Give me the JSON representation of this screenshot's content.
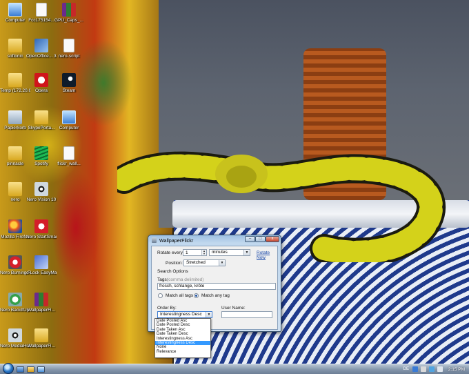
{
  "desktop": {
    "icons": [
      {
        "label": "Computer",
        "icon": "computer-icon"
      },
      {
        "label": "Fcc175154...",
        "icon": "file-icon"
      },
      {
        "label": "GPU_Caps_...",
        "icon": "archive-icon"
      },
      {
        "label": "softonic",
        "icon": "folder-icon"
      },
      {
        "label": "OpenOffice... 3.2",
        "icon": "openoffice-icon"
      },
      {
        "label": "nero-script",
        "icon": "file-icon"
      },
      {
        "label": "Temp (172.20.60...",
        "icon": "folder-icon"
      },
      {
        "label": "Opera",
        "icon": "opera-icon"
      },
      {
        "label": "Steam",
        "icon": "steam-icon"
      },
      {
        "label": "Papierkorb",
        "icon": "recycle-bin-icon"
      },
      {
        "label": "SkypePorta...",
        "icon": "folder-icon"
      },
      {
        "label": "Computer",
        "icon": "computer-icon"
      },
      {
        "label": "pinnacle",
        "icon": "folder-icon"
      },
      {
        "label": "Spotify",
        "icon": "spotify-icon"
      },
      {
        "label": "flickr_wall...",
        "icon": "file-icon"
      },
      {
        "label": "nero",
        "icon": "folder-icon"
      },
      {
        "label": "Nero Vision 10",
        "icon": "nero-vision-icon"
      },
      {
        "label": "Mozilla Firefox",
        "icon": "firefox-icon"
      },
      {
        "label": "Nero StartSmart 10",
        "icon": "nero-startsmart-icon"
      },
      {
        "label": "Nero Burning ROM 10",
        "icon": "nero-burning-icon"
      },
      {
        "label": "c-Lock EasyMail 6",
        "icon": "easymail-icon"
      },
      {
        "label": "Nero BackItUp 10",
        "icon": "nero-backitup-icon"
      },
      {
        "label": "WallpaperFl...",
        "icon": "archive-icon"
      },
      {
        "label": "Nero MediaHub 10",
        "icon": "nero-mediahub-icon"
      },
      {
        "label": "WallpaperFl...",
        "icon": "folder-icon"
      }
    ]
  },
  "window": {
    "title": "WallpaperFlickr",
    "rotate_every_label": "Rotate every:",
    "rotate_every_value": "1",
    "rotate_unit": "minutes",
    "rotate_now": "Rotate Now",
    "position_label": "Position:",
    "position_value": "Stretched",
    "search_options_label": "Search Options",
    "tags_label": "Tags:",
    "tags_hint": "(comma delimited)",
    "tags_value": "frosch, schlange, kröte",
    "match_all_label": "Match all tags",
    "match_any_label": "Match any tag",
    "match_any_selected": true,
    "order_by_label": "Order By:",
    "order_by_value": "Interestingness Desc",
    "username_label": "User Name:",
    "username_value": "",
    "order_options": [
      "Date Posted Asc",
      "Date Posted Desc",
      "Date Taken Asc",
      "Date Taken Desc",
      "Interestingness Asc",
      "Interestingness Desc",
      "None",
      "Relevance"
    ],
    "order_selected_index": 5,
    "minimize_glyph": "–",
    "maximize_glyph": "□",
    "close_glyph": "x"
  },
  "taskbar": {
    "language": "DE",
    "clock": "2:15 PM"
  },
  "colors": {
    "accent": "#3399ff",
    "link": "#1646a8",
    "taskbar": "#8496ab"
  }
}
